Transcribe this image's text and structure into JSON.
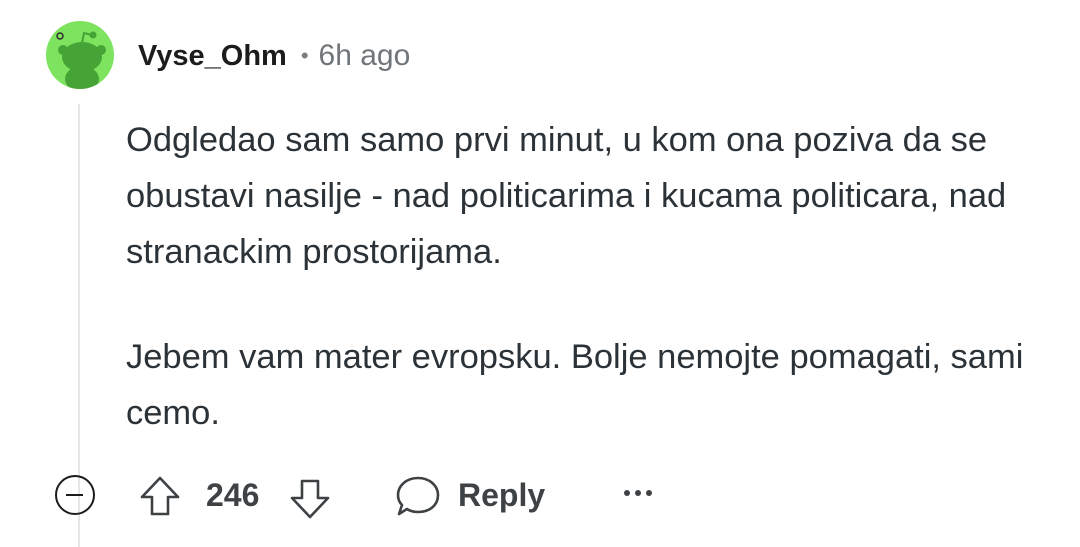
{
  "comment": {
    "author": "Vyse_Ohm",
    "separator": "•",
    "age": "6h ago",
    "paragraphs": [
      "Odgledao sam samo prvi minut, u kom ona poziva da se obustavi nasilje - nad politicarima i kucama politicara, nad stranackim prostorijama.",
      "Jebem vam mater evropsku. Bolje nemojte pomagati, sami cemo."
    ]
  },
  "actions": {
    "score": "246",
    "reply_label": "Reply"
  },
  "colors": {
    "avatar_bg": "#7ee35e",
    "avatar_figure": "#46a436",
    "text": "#2c3338",
    "muted": "#6f7578"
  },
  "icons": [
    "snoo-avatar-icon",
    "collapse-icon",
    "upvote-icon",
    "downvote-icon",
    "reply-bubble-icon",
    "more-options-icon"
  ]
}
